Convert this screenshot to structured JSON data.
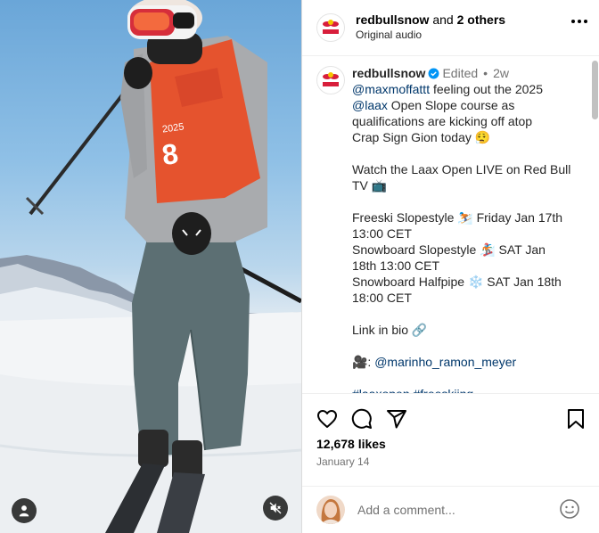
{
  "header": {
    "username": "redbullsnow",
    "and_text": " and ",
    "others": "2 others",
    "audio": "Original audio"
  },
  "caption": {
    "username": "redbullsnow",
    "edited": "Edited",
    "dot": "•",
    "time_ago": "2w",
    "lines": [
      {
        "mention": "@maxmoffattt",
        "text": " feeling out the 2025"
      },
      {
        "mention": "@laax",
        "text": " Open Slope course as"
      },
      {
        "text": "qualifications are kicking off atop"
      },
      {
        "text": "Crap Sign Gion today 😮‍💨"
      },
      {
        "text": ""
      },
      {
        "text": "Watch the Laax Open LIVE on Red Bull"
      },
      {
        "text": "TV 📺"
      },
      {
        "text": ""
      },
      {
        "text": "Freeski Slopestyle ⛷️ Friday Jan 17th"
      },
      {
        "text": "13:00 CET"
      },
      {
        "text": "Snowboard Slopestyle 🏂 SAT Jan"
      },
      {
        "text": "18th 13:00 CET"
      },
      {
        "text": "Snowboard Halfpipe ❄️ SAT Jan 18th"
      },
      {
        "text": "18:00 CET"
      },
      {
        "text": ""
      },
      {
        "text": "Link in bio 🔗"
      },
      {
        "text": ""
      },
      {
        "emoji": "🎥: ",
        "mention": "@marinho_ramon_meyer"
      },
      {
        "text": ""
      },
      {
        "mention": "#laaxopen #freeskiing"
      }
    ]
  },
  "actions": {
    "likes": "12,678 likes",
    "date": "January 14",
    "icons": [
      "heart-icon",
      "comment-icon",
      "share-icon",
      "bookmark-icon"
    ]
  },
  "comment": {
    "placeholder": "Add a comment..."
  },
  "media": {
    "bib_year": "2025",
    "bib_number": "8",
    "icons": [
      "user-tag-icon",
      "mute-icon"
    ]
  },
  "colors": {
    "mention": "#00376b",
    "verified": "#0095f6",
    "secondary_text": "#737373",
    "redbull_red": "#d81e3b"
  }
}
